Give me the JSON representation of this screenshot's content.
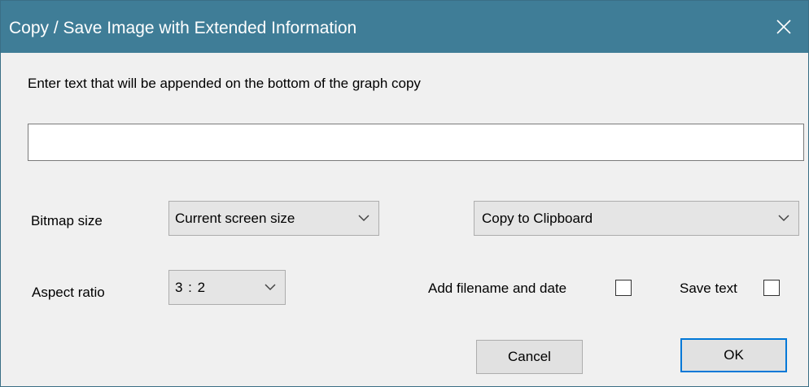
{
  "dialog": {
    "title": "Copy / Save Image with Extended Information",
    "close_icon": "close-icon"
  },
  "form": {
    "append_text_label": "Enter text that will be appended on the bottom of the graph copy",
    "append_text_value": "",
    "bitmap_size_label": "Bitmap size",
    "bitmap_size_value": "Current screen size",
    "destination_value": "Copy to Clipboard",
    "aspect_ratio_label": "Aspect ratio",
    "aspect_ratio_value": "3 : 2",
    "add_filename_label": "Add filename and date",
    "add_filename_checked": false,
    "save_text_label": "Save text",
    "save_text_checked": false
  },
  "buttons": {
    "cancel_label": "Cancel",
    "ok_label": "OK"
  },
  "colors": {
    "titlebar": "#3f7d97",
    "dialog_bg": "#f0f0f0",
    "default_button_border": "#0078d7"
  }
}
